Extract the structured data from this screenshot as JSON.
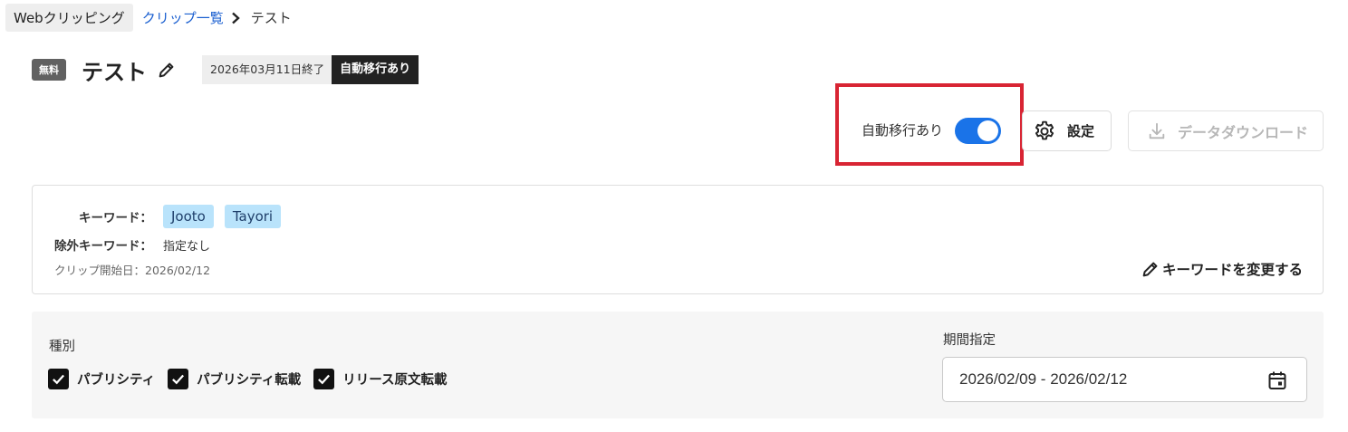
{
  "breadcrumb": {
    "root": "Webクリッピング",
    "list_link": "クリップ一覧",
    "current": "テスト"
  },
  "header": {
    "plan_badge": "無料",
    "title": "テスト",
    "end_date": "2026年03月11日終了",
    "migrate_tag": "自動移行あり"
  },
  "toolbar": {
    "toggle_label": "自動移行あり",
    "toggle_on": true,
    "settings_label": "設定",
    "download_label": "データダウンロード",
    "accent_color": "#1a73e8",
    "highlight_color": "#d82433"
  },
  "keywords": {
    "keyword_label": "キーワード：",
    "keywords": [
      "Jooto",
      "Tayori"
    ],
    "exclude_label": "除外キーワード：",
    "exclude_value": "指定なし",
    "start_date": "クリップ開始日：2026/02/12",
    "change_label": "キーワードを変更する"
  },
  "filters": {
    "type_label": "種別",
    "types": [
      {
        "label": "パブリシティ",
        "checked": true
      },
      {
        "label": "パブリシティ転載",
        "checked": true
      },
      {
        "label": "リリース原文転載",
        "checked": true
      }
    ],
    "period_label": "期間指定",
    "period_value": "2026/02/09 - 2026/02/12"
  }
}
